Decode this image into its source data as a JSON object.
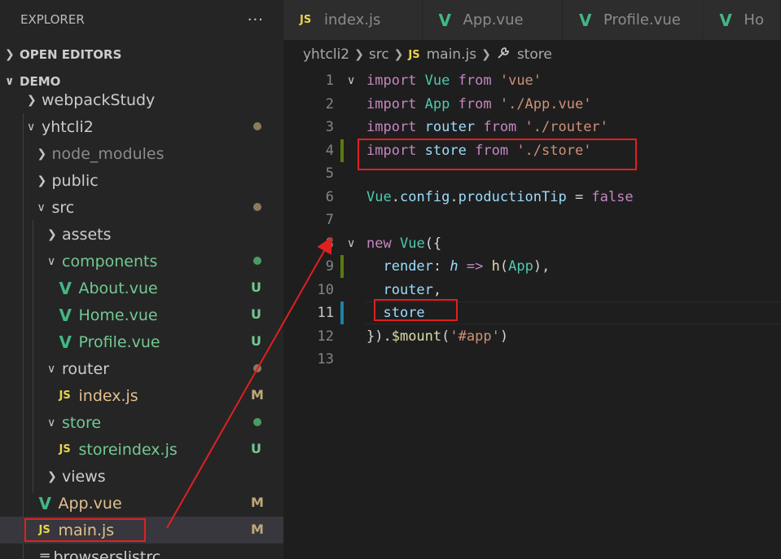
{
  "sidebar": {
    "title": "EXPLORER",
    "more": "···",
    "open_editors": "OPEN EDITORS",
    "project": "DEMO",
    "tree": [
      {
        "label": "webpackStudy",
        "kind": "folder",
        "depth": 1,
        "open": false,
        "color": "#cccccc"
      },
      {
        "label": "yhtcli2",
        "kind": "folder",
        "depth": 1,
        "open": true,
        "color": "#cccccc",
        "dot": "#8c7a5c"
      },
      {
        "label": "node_modules",
        "kind": "folder",
        "depth": 2,
        "open": false,
        "color": "#8b8b8b"
      },
      {
        "label": "public",
        "kind": "folder",
        "depth": 2,
        "open": false,
        "color": "#cccccc"
      },
      {
        "label": "src",
        "kind": "folder",
        "depth": 2,
        "open": true,
        "color": "#cccccc",
        "dot": "#8c7a5c"
      },
      {
        "label": "assets",
        "kind": "folder",
        "depth": 3,
        "open": false,
        "color": "#cccccc"
      },
      {
        "label": "components",
        "kind": "folder",
        "depth": 3,
        "open": true,
        "color": "#73c991",
        "dot": "#4c9a61"
      },
      {
        "label": "About.vue",
        "kind": "vue",
        "depth": 4,
        "color": "#73c991",
        "badge": "U",
        "badge_color": "#73c991"
      },
      {
        "label": "Home.vue",
        "kind": "vue",
        "depth": 4,
        "color": "#73c991",
        "badge": "U",
        "badge_color": "#73c991"
      },
      {
        "label": "Profile.vue",
        "kind": "vue",
        "depth": 4,
        "color": "#73c991",
        "badge": "U",
        "badge_color": "#73c991"
      },
      {
        "label": "router",
        "kind": "folder",
        "depth": 3,
        "open": true,
        "color": "#cccccc",
        "dot": "#8c7a5c"
      },
      {
        "label": "index.js",
        "kind": "js",
        "depth": 4,
        "color": "#e2c08d",
        "badge": "M",
        "badge_color": "#c0a878"
      },
      {
        "label": "store",
        "kind": "folder",
        "depth": 3,
        "open": true,
        "color": "#73c991",
        "dot": "#4c9a61"
      },
      {
        "label": "storeindex.js",
        "kind": "js",
        "depth": 4,
        "color": "#73c991",
        "badge": "U",
        "badge_color": "#73c991"
      },
      {
        "label": "views",
        "kind": "folder",
        "depth": 3,
        "open": false,
        "color": "#cccccc"
      },
      {
        "label": "App.vue",
        "kind": "vue",
        "depth": 2,
        "color": "#e2c08d",
        "badge": "M",
        "badge_color": "#c0a878"
      },
      {
        "label": "main.js",
        "kind": "js",
        "depth": 2,
        "color": "#e2c08d",
        "badge": "M",
        "badge_color": "#c0a878",
        "selected": true
      },
      {
        "label": "browserslistrc",
        "kind": "file",
        "depth": 2,
        "color": "#cccccc"
      }
    ]
  },
  "tabs": [
    {
      "label": "index.js",
      "kind": "js"
    },
    {
      "label": "App.vue",
      "kind": "vue"
    },
    {
      "label": "Profile.vue",
      "kind": "vue"
    },
    {
      "label": "Ho",
      "kind": "vue"
    }
  ],
  "breadcrumb": {
    "parts": [
      "yhtcli2",
      "src",
      "main.js",
      "store"
    ]
  },
  "code": {
    "lines": [
      {
        "n": "1",
        "fold": "∨",
        "tokens": [
          [
            "kw",
            "import"
          ],
          [
            "punc",
            " "
          ],
          [
            "id",
            "Vue"
          ],
          [
            "punc",
            " "
          ],
          [
            "kw",
            "from"
          ],
          [
            "punc",
            " "
          ],
          [
            "str",
            "'vue'"
          ]
        ]
      },
      {
        "n": "2",
        "tokens": [
          [
            "kw",
            "import"
          ],
          [
            "punc",
            " "
          ],
          [
            "id",
            "App"
          ],
          [
            "punc",
            " "
          ],
          [
            "kw",
            "from"
          ],
          [
            "punc",
            " "
          ],
          [
            "str",
            "'./App.vue'"
          ]
        ]
      },
      {
        "n": "3",
        "tokens": [
          [
            "kw",
            "import"
          ],
          [
            "punc",
            " "
          ],
          [
            "var",
            "router"
          ],
          [
            "punc",
            " "
          ],
          [
            "kw",
            "from"
          ],
          [
            "punc",
            " "
          ],
          [
            "str",
            "'./router'"
          ]
        ]
      },
      {
        "n": "4",
        "mod": "#587c0c",
        "tokens": [
          [
            "kw",
            "import"
          ],
          [
            "punc",
            " "
          ],
          [
            "var",
            "store"
          ],
          [
            "punc",
            " "
          ],
          [
            "kw",
            "from"
          ],
          [
            "punc",
            " "
          ],
          [
            "str",
            "'./store'"
          ]
        ]
      },
      {
        "n": "5",
        "tokens": []
      },
      {
        "n": "6",
        "tokens": [
          [
            "id",
            "Vue"
          ],
          [
            "punc",
            "."
          ],
          [
            "var",
            "config"
          ],
          [
            "punc",
            "."
          ],
          [
            "var",
            "productionTip"
          ],
          [
            "punc",
            " = "
          ],
          [
            "kw",
            "false"
          ]
        ]
      },
      {
        "n": "7",
        "tokens": []
      },
      {
        "n": "8",
        "fold": "∨",
        "tokens": [
          [
            "kw",
            "new"
          ],
          [
            "punc",
            " "
          ],
          [
            "id",
            "Vue"
          ],
          [
            "punc",
            "({"
          ]
        ]
      },
      {
        "n": "9",
        "mod": "#587c0c",
        "tokens": [
          [
            "punc",
            "  "
          ],
          [
            "var",
            "render"
          ],
          [
            "punc",
            ": "
          ],
          [
            "prm",
            "h"
          ],
          [
            "punc",
            " "
          ],
          [
            "kw",
            "=>"
          ],
          [
            "punc",
            " "
          ],
          [
            "fn",
            "h"
          ],
          [
            "punc",
            "("
          ],
          [
            "id",
            "App"
          ],
          [
            "punc",
            "),"
          ]
        ]
      },
      {
        "n": "10",
        "tokens": [
          [
            "punc",
            "  "
          ],
          [
            "var",
            "router"
          ],
          [
            "punc",
            ","
          ]
        ]
      },
      {
        "n": "11",
        "mod": "#1b81a8",
        "current": true,
        "tokens": [
          [
            "punc",
            "  "
          ],
          [
            "var",
            "store"
          ]
        ]
      },
      {
        "n": "12",
        "tokens": [
          [
            "punc",
            "})."
          ],
          [
            "fn",
            "$mount"
          ],
          [
            "punc",
            "("
          ],
          [
            "str",
            "'#app'"
          ],
          [
            "punc",
            ")"
          ]
        ]
      },
      {
        "n": "13",
        "tokens": []
      }
    ]
  },
  "colors": {
    "annotation": "#e02020",
    "accent_js": "#e8d44d",
    "accent_vue": "#41b883"
  }
}
